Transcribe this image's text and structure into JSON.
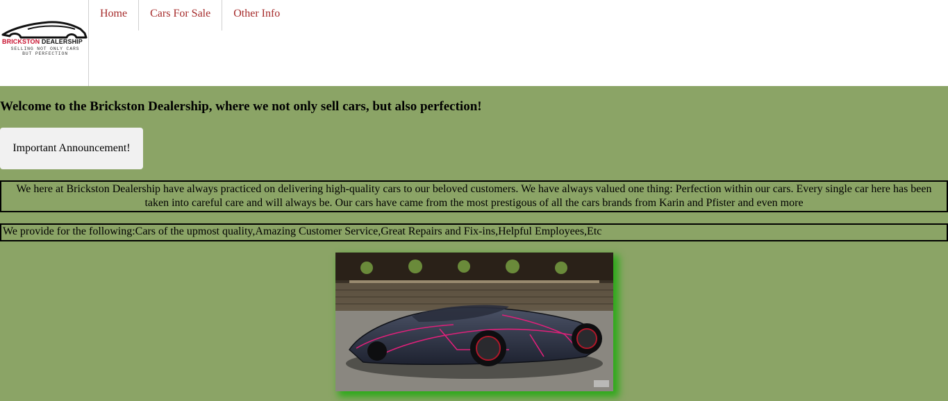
{
  "logo": {
    "brand_part1": "BRICKSTON",
    "brand_part2": "DEALERSHIP",
    "tagline_line1": "SELLING NOT ONLY CARS",
    "tagline_line2": "BUT PERFECTION"
  },
  "nav": {
    "items": [
      {
        "label": "Home"
      },
      {
        "label": "Cars For Sale"
      },
      {
        "label": "Other Info"
      }
    ]
  },
  "main": {
    "welcome_heading": "Welcome to the Brickston Dealership, where we not only sell cars, but also perfection!",
    "announcement_button": "Important Announcement!",
    "about_text": "We here at Brickston Dealership have always practiced on delivering high-quality cars to our beloved customers. We have always valued one thing: Perfection within our cars. Every single car here has been taken into careful care and will always be. Our cars have came from the most prestigous of all the cars brands from Karin and Pfister and even more",
    "services_text": "We provide for the following:Cars of the upmost quality,Amazing Customer Service,Great Repairs and Fix-ins,Helpful Employees,Etc"
  },
  "colors": {
    "main_background": "#8ba466",
    "nav_link": "#a52a2a",
    "image_shadow": "#2eaa1a",
    "logo_accent": "#c8102e"
  }
}
